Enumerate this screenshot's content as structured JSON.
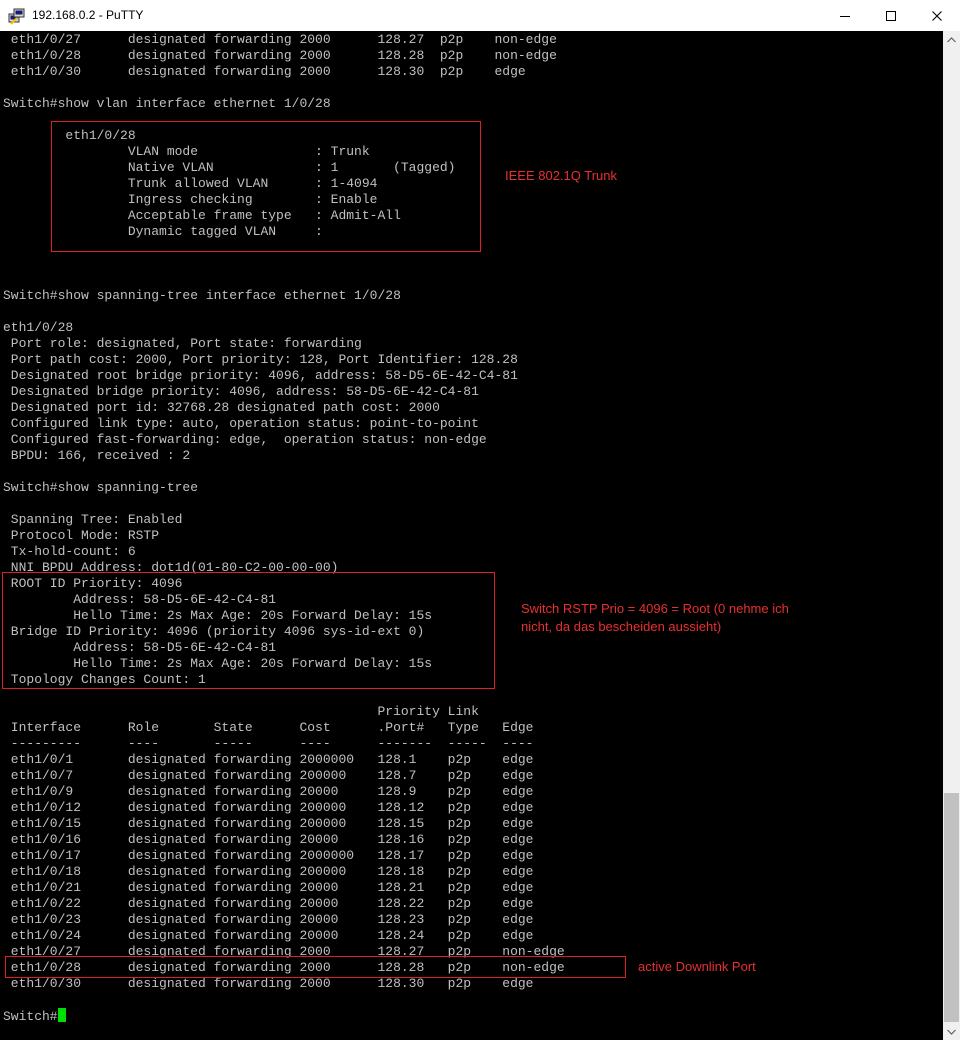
{
  "window": {
    "title": "192.168.0.2 - PuTTY",
    "icon": "putty-icon",
    "controls": [
      "minimize-icon",
      "maximize-icon",
      "close-icon"
    ]
  },
  "terminal": {
    "background": "#000000",
    "text_color": "#c0c0c0",
    "cursor_color": "#00e000",
    "prompt": "Switch#",
    "lines": [
      " eth1/0/27      designated forwarding 2000      128.27  p2p    non-edge",
      " eth1/0/28      designated forwarding 2000      128.28  p2p    non-edge",
      " eth1/0/30      designated forwarding 2000      128.30  p2p    edge",
      "",
      "Switch#show vlan interface ethernet 1/0/28",
      "",
      "        eth1/0/28",
      "                VLAN mode               : Trunk",
      "                Native VLAN             : 1       (Tagged)",
      "                Trunk allowed VLAN      : 1-4094",
      "                Ingress checking        : Enable",
      "                Acceptable frame type   : Admit-All",
      "                Dynamic tagged VLAN     :",
      "",
      "",
      "",
      "Switch#show spanning-tree interface ethernet 1/0/28",
      "",
      "eth1/0/28",
      " Port role: designated, Port state: forwarding",
      " Port path cost: 2000, Port priority: 128, Port Identifier: 128.28",
      " Designated root bridge priority: 4096, address: 58-D5-6E-42-C4-81",
      " Designated bridge priority: 4096, address: 58-D5-6E-42-C4-81",
      " Designated port id: 32768.28 designated path cost: 2000",
      " Configured link type: auto, operation status: point-to-point",
      " Configured fast-forwarding: edge,  operation status: non-edge",
      " BPDU: 166, received : 2",
      "",
      "Switch#show spanning-tree",
      "",
      " Spanning Tree: Enabled",
      " Protocol Mode: RSTP",
      " Tx-hold-count: 6",
      " NNI BPDU Address: dot1d(01-80-C2-00-00-00)",
      " ROOT ID Priority: 4096",
      "         Address: 58-D5-6E-42-C4-81",
      "         Hello Time: 2s Max Age: 20s Forward Delay: 15s",
      " Bridge ID Priority: 4096 (priority 4096 sys-id-ext 0)",
      "         Address: 58-D5-6E-42-C4-81",
      "         Hello Time: 2s Max Age: 20s Forward Delay: 15s",
      " Topology Changes Count: 1",
      "",
      "                                                Priority Link",
      " Interface      Role       State      Cost      .Port#   Type   Edge",
      " ---------      ----       -----      ----      -------  -----  ----",
      " eth1/0/1       designated forwarding 2000000   128.1    p2p    edge",
      " eth1/0/7       designated forwarding 200000    128.7    p2p    edge",
      " eth1/0/9       designated forwarding 20000     128.9    p2p    edge",
      " eth1/0/12      designated forwarding 200000    128.12   p2p    edge",
      " eth1/0/15      designated forwarding 200000    128.15   p2p    edge",
      " eth1/0/16      designated forwarding 20000     128.16   p2p    edge",
      " eth1/0/17      designated forwarding 2000000   128.17   p2p    edge",
      " eth1/0/18      designated forwarding 200000    128.18   p2p    edge",
      " eth1/0/21      designated forwarding 20000     128.21   p2p    edge",
      " eth1/0/22      designated forwarding 20000     128.22   p2p    edge",
      " eth1/0/23      designated forwarding 20000     128.23   p2p    edge",
      " eth1/0/24      designated forwarding 20000     128.24   p2p    edge",
      " eth1/0/27      designated forwarding 2000      128.27   p2p    non-edge",
      " eth1/0/28      designated forwarding 2000      128.28   p2p    non-edge",
      " eth1/0/30      designated forwarding 2000      128.30   p2p    edge",
      ""
    ]
  },
  "annotations": {
    "color": "#e02020",
    "vlan_trunk": "IEEE 802.1Q Trunk",
    "rstp_root": "Switch RSTP Prio = 4096 = Root (0 nehme ich\nnicht, da das bescheiden aussieht)",
    "downlink": "active Downlink Port"
  }
}
